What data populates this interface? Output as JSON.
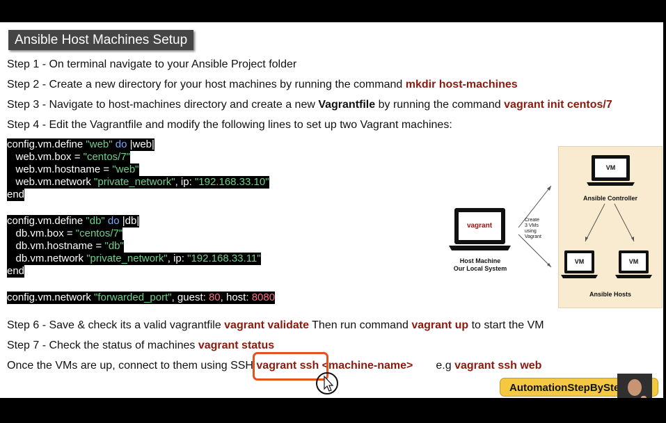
{
  "title": "Ansible Host Machines Setup",
  "steps": {
    "s1": "Step 1 - On terminal navigate to your Ansible Project folder",
    "s2_text": "Step 2 - Create a new directory for your host machines by running the command ",
    "s2_cmd": "mkdir host-machines",
    "s3_text": "Step 3 - Navigate to host-machines directory and create a new ",
    "s3_file": "Vagrantfile",
    "s3_text2": " by running the command ",
    "s3_cmd": "vagrant init centos/7",
    "s4": "Step 4 - Edit the Vagrantfile and modify the following lines to set up two Vagrant machines:",
    "s6_text": "Step 6 - Save & check its a valid vagrantfile ",
    "s6_cmd1": "vagrant validate",
    "s6_text2": " Then run command ",
    "s6_cmd2": "vagrant up",
    "s6_text3": " to start the VM",
    "s7_text": "Step 7 - Check the status of machines ",
    "s7_cmd": "vagrant status",
    "ssh_text": "Once the VMs are up, connect to them using SSH ",
    "ssh_cmd": "vagrant ssh <machine-name>",
    "ssh_eg": "e.g ",
    "ssh_eg_cmd": "vagrant ssh web"
  },
  "code": {
    "web_define": "config.vm.define ",
    "web_name": "\"web\"",
    "do": " do ",
    "web_var": "|web|",
    "web_box_key": "   web.vm.box = ",
    "web_box_val": "\"centos/7\"",
    "web_host_key": "   web.vm.hostname = ",
    "web_host_val": "\"web\"",
    "web_net_key": "   web.vm.network ",
    "web_net_type": "\"private_network\"",
    "web_net_ip_key": ", ip: ",
    "web_net_ip": "\"192.168.33.10\"",
    "end": "end",
    "db_define": "config.vm.define ",
    "db_name": "\"db\"",
    "db_var": "|db|",
    "db_box_key": "   db.vm.box = ",
    "db_box_val": "\"centos/7\"",
    "db_host_key": "   db.vm.hostname = ",
    "db_host_val": "\"db\"",
    "db_net_key": "   db.vm.network ",
    "db_net_type": "\"private_network\"",
    "db_net_ip_key": ", ip: ",
    "db_net_ip": "\"192.168.33.11\"",
    "fwd_key": "config.vm.network ",
    "fwd_type": "\"forwarded_port\"",
    "fwd_guest_key": ", guest: ",
    "fwd_guest": "80",
    "fwd_host_key": ", host: ",
    "fwd_host": "8080"
  },
  "diagram": {
    "host_screen": "vagrant",
    "host_label1": "Host Machine",
    "host_label2": "Our Local System",
    "arrow_note1": "Create",
    "arrow_note2": "3 VMs",
    "arrow_note3": "using",
    "arrow_note4": "Vagrant",
    "vm": "VM",
    "controller": "Ansible Controller",
    "hosts": "Ansible Hosts"
  },
  "badge": "AutomationStepByStep.com",
  "colors": {
    "command": "#8b1a0e",
    "string": "#6fd08c",
    "keyword": "#7aa8ff",
    "number": "#ff6b85",
    "highlight": "#e8501e",
    "badge": "#f5c842"
  }
}
